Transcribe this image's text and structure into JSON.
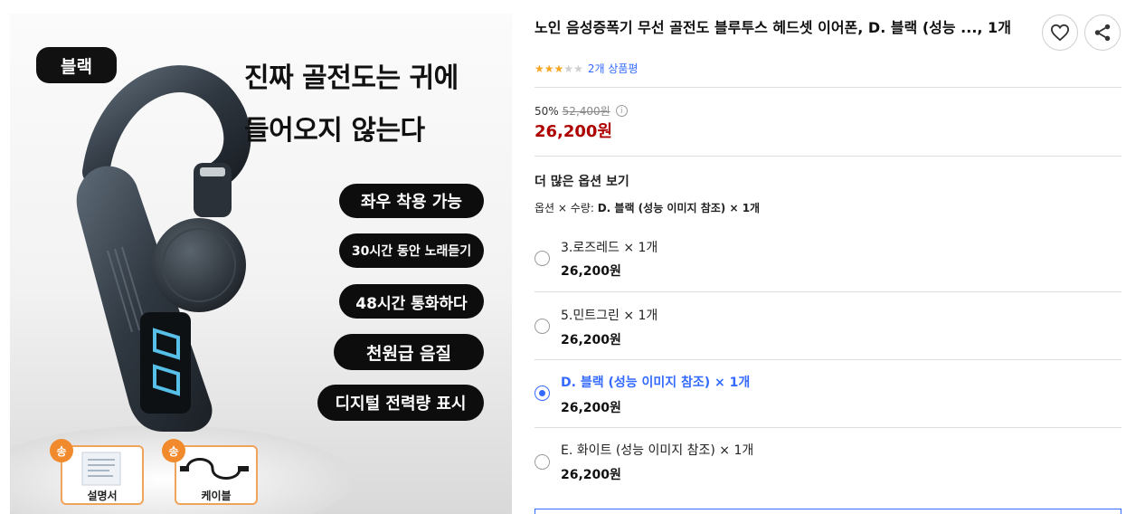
{
  "hero": {
    "color_badge": "블랙",
    "headline_line1": "진짜 골전도는 귀에",
    "headline_line2": "들어오지 않는다",
    "features": [
      "좌우 착용 가능",
      "30시간 동안 노래듣기",
      "48시간 통화하다",
      "천원급 음질",
      "디지털 전력량 표시"
    ],
    "accessories": [
      {
        "badge": "송",
        "label": "설명서",
        "icon": "manual-icon"
      },
      {
        "badge": "송",
        "label": "케이블",
        "icon": "cable-icon"
      }
    ]
  },
  "product": {
    "title": "노인 음성증폭기 무선 골전도 블루투스 헤드셋 이어폰, D. 블랙 (성능 ..., 1개",
    "rating": {
      "stars": 3,
      "max_stars": 5,
      "review_text": "2개 상품평"
    },
    "discount_rate": "50%",
    "original_price": "52,400원",
    "sale_price": "26,200원",
    "more_options_label": "더 많은 옵션 보기",
    "selected_summary_prefix": "옵션 × 수량:",
    "selected_summary_value": "D. 블랙 (성능 이미지 참조) × 1개"
  },
  "options": [
    {
      "name": "3.로즈레드 × 1개",
      "price": "26,200원",
      "selected": false
    },
    {
      "name": "5.민트그린 × 1개",
      "price": "26,200원",
      "selected": false
    },
    {
      "name": "D. 블랙 (성능 이미지 참조) × 1개",
      "price": "26,200원",
      "selected": true
    },
    {
      "name": "E. 화이트 (성능 이미지 참조) × 1개",
      "price": "26,200원",
      "selected": false
    }
  ],
  "icons": {
    "wishlist": "heart-icon",
    "share": "share-icon",
    "info": "info-icon"
  },
  "colors": {
    "accent": "#346aff",
    "price": "#ae0000",
    "star": "#f5a623"
  }
}
